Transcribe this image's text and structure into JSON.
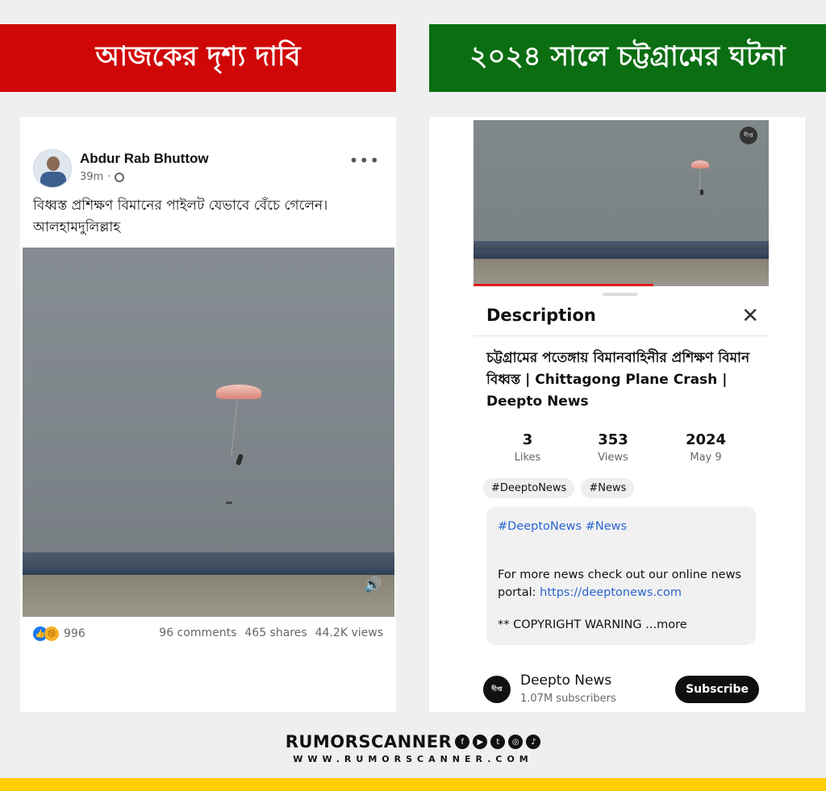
{
  "banners": {
    "left": "আজকের দৃশ্য দাবি",
    "right": "২০২৪ সালে চট্টগ্রামের ঘটনা"
  },
  "facebook": {
    "author": "Abdur Rab Bhuttow",
    "time": "39m",
    "post_text": "বিধ্বস্ত প্রশিক্ষণ বিমানের পাইলট যেভাবে বেঁচে গেলেন। আলহামদুলিল্লাহ",
    "reactions_count": "996",
    "comments": "96 comments",
    "shares": "465 shares",
    "views": "44.2K views",
    "icons": [
      "globe-icon",
      "more-icon",
      "speaker-icon",
      "like-icon",
      "sad-icon"
    ]
  },
  "youtube": {
    "video_progress": 0.61,
    "description_heading": "Description",
    "video_title": "চট্টগ্রামের পতেঙ্গায় বিমানবাহিনীর প্রশিক্ষণ বিমান বিধ্বস্ত | Chittagong Plane Crash | Deepto News",
    "stats": [
      {
        "value": "3",
        "label": "Likes"
      },
      {
        "value": "353",
        "label": "Views"
      },
      {
        "value": "2024",
        "label": "May 9"
      }
    ],
    "chips": [
      "#DeeptoNews",
      "#News"
    ],
    "description": {
      "tags": "#DeeptoNews #News",
      "body": "For more news check out our online news portal:",
      "link": "https://deeptonews.com",
      "warning": "** COPYRIGHT WARNING",
      "more": "...more"
    },
    "channel": {
      "name": "Deepto News",
      "subscribers": "1.07M subscribers",
      "subscribe_label": "Subscribe"
    }
  },
  "footer": {
    "brand": "RUMORSCANNER",
    "url": "WWW.RUMORSCANNER.COM",
    "social_icons": [
      "facebook-icon",
      "youtube-icon",
      "twitter-icon",
      "instagram-icon",
      "tiktok-icon"
    ]
  },
  "colors": {
    "left_banner": "#d00707",
    "right_banner": "#0b6e12",
    "footer_bar": "#ffcd00",
    "link": "#2a66d4",
    "progress": "#e21b1b"
  }
}
